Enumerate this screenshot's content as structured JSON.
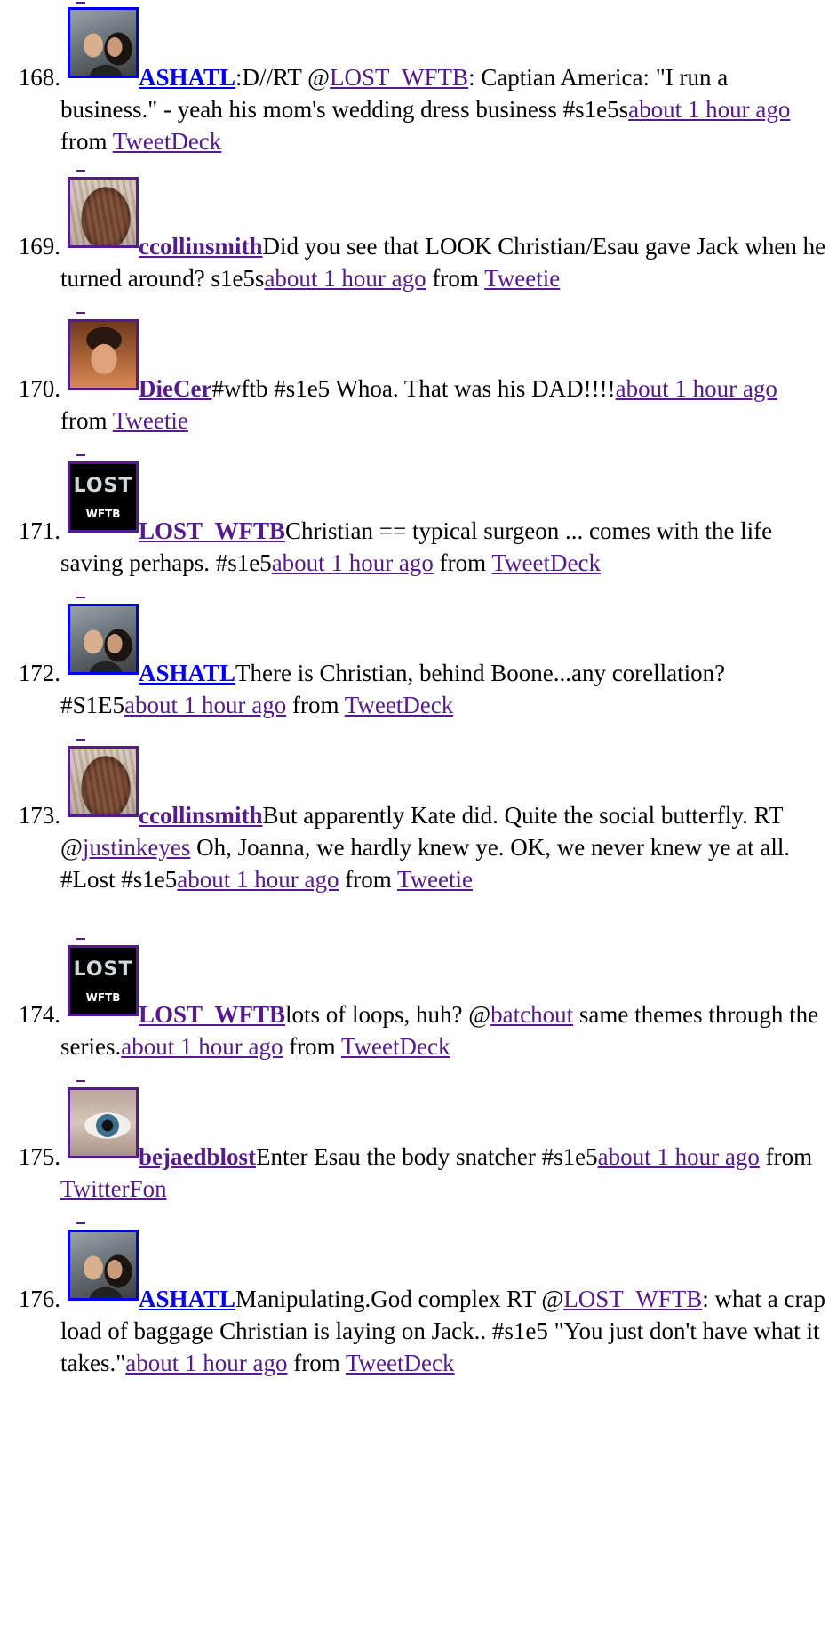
{
  "top_dash": true,
  "tweets": [
    {
      "number": "168.",
      "avatar": "couple",
      "user": "ASHATL",
      "user_visited": false,
      "parts": [
        {
          "t": ":D//RT @"
        },
        {
          "link": "LOST_WFTB"
        },
        {
          "t": ": Captian America: \"I run a business.\" - yeah his mom's wedding dress business #s1e5s"
        },
        {
          "link": "about 1 hour ago"
        },
        {
          "t": " from "
        },
        {
          "link": "TweetDeck"
        }
      ]
    },
    {
      "number": "169.",
      "avatar": "hair",
      "user": "ccollinsmith",
      "user_visited": true,
      "parts": [
        {
          "t": "Did you see that LOOK Christian/Esau gave Jack when he turned around? s1e5s"
        },
        {
          "link": "about 1 hour ago"
        },
        {
          "t": " from "
        },
        {
          "link": "Tweetie"
        }
      ]
    },
    {
      "number": "170.",
      "avatar": "guy",
      "user": "DieCer",
      "user_visited": true,
      "parts": [
        {
          "t": "#wftb #s1e5 Whoa. That was his DAD!!!!"
        },
        {
          "link": "about 1 hour ago"
        },
        {
          "t": " from "
        },
        {
          "link": "Tweetie"
        }
      ]
    },
    {
      "number": "171.",
      "avatar": "lost",
      "avatar_logo": "LOST",
      "avatar_sub": "WFTB",
      "user": "LOST_WFTB",
      "user_visited": true,
      "parts": [
        {
          "t": "Christian == typical surgeon ... comes with the life saving perhaps. #s1e5"
        },
        {
          "link": "about 1 hour ago"
        },
        {
          "t": " from "
        },
        {
          "link": "TweetDeck"
        }
      ]
    },
    {
      "number": "172.",
      "avatar": "couple",
      "user": "ASHATL",
      "user_visited": false,
      "parts": [
        {
          "t": "There is Christian, behind Boone...any corellation? #S1E5"
        },
        {
          "link": "about 1 hour ago"
        },
        {
          "t": " from "
        },
        {
          "link": "TweetDeck"
        }
      ]
    },
    {
      "number": "173.",
      "avatar": "hair",
      "user": "ccollinsmith",
      "user_visited": true,
      "parts": [
        {
          "t": "But apparently Kate did. Quite the social butterfly. RT @"
        },
        {
          "link": "justinkeyes"
        },
        {
          "t": " Oh, Joanna, we hardly knew ye. OK, we never knew ye at all. #Lost #s1e5"
        },
        {
          "link": "about 1 hour ago"
        },
        {
          "t": " from "
        },
        {
          "link": "Tweetie"
        }
      ]
    },
    {
      "number": "174.",
      "avatar": "lost",
      "avatar_logo": "LOST",
      "avatar_sub": "WFTB",
      "user": "LOST_WFTB",
      "user_visited": true,
      "parts": [
        {
          "t": "lots of loops, huh? @"
        },
        {
          "link": "batchout"
        },
        {
          "t": " same themes through the series."
        },
        {
          "link": "about 1 hour ago"
        },
        {
          "t": " from "
        },
        {
          "link": "TweetDeck"
        }
      ]
    },
    {
      "number": "175.",
      "avatar": "eye",
      "user": "bejaedblost",
      "user_visited": true,
      "parts": [
        {
          "t": "Enter Esau the body snatcher #s1e5"
        },
        {
          "link": "about 1 hour ago"
        },
        {
          "t": " from "
        },
        {
          "link": "TwitterFon"
        }
      ]
    },
    {
      "number": "176.",
      "avatar": "couple",
      "user": "ASHATL",
      "user_visited": false,
      "parts": [
        {
          "t": "Manipulating.God complex RT @"
        },
        {
          "link": "LOST_WFTB"
        },
        {
          "t": ": what a crap load of baggage Christian is laying on Jack.. #s1e5 \"You just don't have what it takes.\""
        },
        {
          "link": "about 1 hour ago"
        },
        {
          "t": " from "
        },
        {
          "link": "TweetDeck"
        }
      ]
    }
  ]
}
